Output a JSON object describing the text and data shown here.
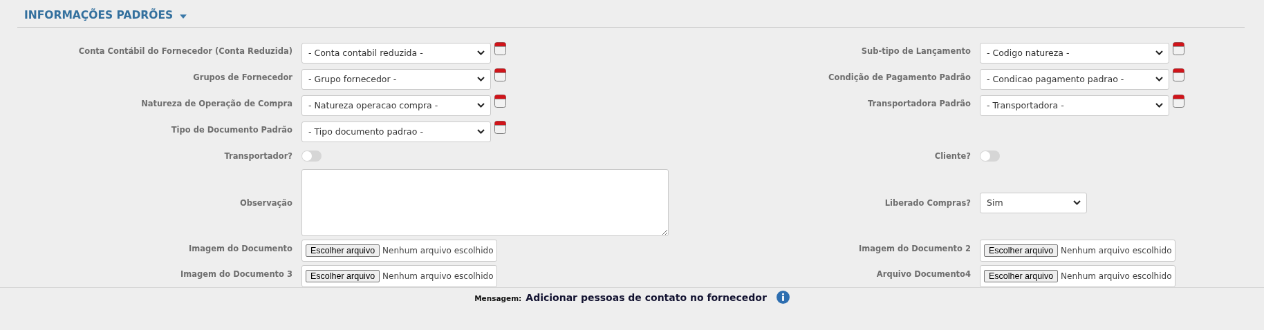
{
  "section": {
    "title": "INFORMAÇÕES PADRÕES",
    "expanded": true
  },
  "rows": [
    {
      "left": {
        "kind": "select",
        "label": "Conta Contábil do Fornecedor (Conta Reduzida)",
        "value": "- Conta contabil reduzida -",
        "calendar": true
      },
      "right": {
        "kind": "select",
        "label": "Sub-tipo de Lançamento",
        "value": "- Codigo natureza -",
        "calendar": true
      }
    },
    {
      "left": {
        "kind": "select",
        "label": "Grupos de Fornecedor",
        "value": "- Grupo fornecedor -",
        "calendar": true
      },
      "right": {
        "kind": "select",
        "label": "Condição de Pagamento Padrão",
        "value": "- Condicao pagamento padrao -",
        "calendar": true
      }
    },
    {
      "left": {
        "kind": "select",
        "label": "Natureza de Operação de Compra",
        "value": "- Natureza operacao compra -",
        "calendar": true
      },
      "right": {
        "kind": "select",
        "label": "Transportadora Padrão",
        "value": "- Transportadora -",
        "calendar": true
      }
    },
    {
      "left": {
        "kind": "select",
        "label": "Tipo de Documento Padrão",
        "value": "- Tipo documento padrao -",
        "calendar": true
      }
    },
    {
      "left": {
        "kind": "toggle",
        "label": "Transportador?",
        "on": false
      },
      "right": {
        "kind": "toggle",
        "label": "Cliente?",
        "on": false
      }
    },
    {
      "left": {
        "kind": "textarea",
        "label": "Observação"
      },
      "right": {
        "kind": "short-select",
        "label": "Liberado Compras?",
        "value": "Sim"
      }
    },
    {
      "left": {
        "kind": "file",
        "label": "Imagem do Documento",
        "button": "Escolher arquivo",
        "status": "Nenhum arquivo escolhido"
      },
      "right": {
        "kind": "file",
        "label": "Imagem do Documento 2",
        "button": "Escolher arquivo",
        "status": "Nenhum arquivo escolhido"
      }
    },
    {
      "left": {
        "kind": "file",
        "label": "Imagem do Documento 3",
        "button": "Escolher arquivo",
        "status": "Nenhum arquivo escolhido"
      },
      "right": {
        "kind": "file",
        "label": "Arquivo Documento4",
        "button": "Escolher arquivo",
        "status": "Nenhum arquivo escolhido"
      }
    }
  ],
  "footer": {
    "label": "Mensagem:",
    "message": "Adicionar pessoas de contato no fornecedor"
  }
}
